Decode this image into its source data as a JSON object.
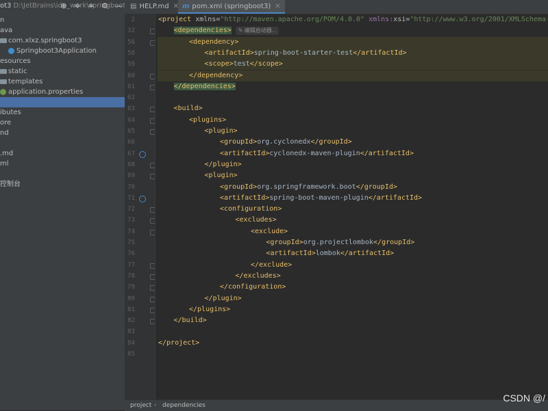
{
  "sidebar": {
    "project_name": "ot3",
    "project_path": "D:\\JetBrains\\ide_work\\springboot3",
    "toolbar_icons": [
      "locate-icon",
      "expand-all-icon",
      "collapse-all-icon",
      "gear-icon",
      "hide-icon"
    ],
    "tree": [
      {
        "label": "n",
        "kind": "text",
        "indent": 0
      },
      {
        "label": "ava",
        "kind": "text",
        "indent": 0
      },
      {
        "label": "com.xlxz.springboot3",
        "kind": "folder",
        "indent": 0
      },
      {
        "label": "Springboot3Application",
        "kind": "class",
        "indent": 1
      },
      {
        "label": "esources",
        "kind": "text",
        "indent": 0
      },
      {
        "label": "static",
        "kind": "folder",
        "indent": 0
      },
      {
        "label": "templates",
        "kind": "folder",
        "indent": 0
      },
      {
        "label": "application.properties",
        "kind": "leaf",
        "indent": 0
      },
      {
        "label": "",
        "kind": "selected",
        "indent": 0
      },
      {
        "label": "ibutes",
        "kind": "text",
        "indent": 0
      },
      {
        "label": "ore",
        "kind": "text",
        "indent": 0
      },
      {
        "label": "nd",
        "kind": "text",
        "indent": 0
      },
      {
        "label": "",
        "kind": "text",
        "indent": 0
      },
      {
        "label": ".md",
        "kind": "text",
        "indent": 0
      },
      {
        "label": "ml",
        "kind": "text",
        "indent": 0
      },
      {
        "label": "",
        "kind": "text",
        "indent": 0
      },
      {
        "label": "控制台",
        "kind": "text",
        "indent": 0
      }
    ]
  },
  "tabs": [
    {
      "label": "HELP.md",
      "icon": "markdown-icon",
      "active": false
    },
    {
      "label": "pom.xml (springboot3)",
      "icon": "maven-icon",
      "icon_char": "m",
      "active": true
    }
  ],
  "editor": {
    "inlay_hint": "编辑启动器...",
    "lines": [
      {
        "n": "2",
        "indent": 0,
        "tag": "<project",
        "attrs": [
          {
            "name": "xmlns",
            "value": "\"http://maven.apache.org/POM/4.0.0\""
          },
          {
            "ns": "xmlns:",
            "name": "xsi",
            "value": "\"http://www.w3.org/2001/XMLSchema-instanc"
          }
        ]
      },
      {
        "n": "32",
        "indent": 1,
        "open": "<dependencies>",
        "boxed": true,
        "inlay": true
      },
      {
        "n": "56",
        "indent": 2,
        "open": "<dependency>",
        "hl": true
      },
      {
        "n": "58",
        "indent": 3,
        "open": "<artifactId>",
        "text": "spring-boot-starter-test",
        "close": "</artifactId>",
        "hl": true
      },
      {
        "n": "59",
        "indent": 3,
        "open": "<scope>",
        "text": "test",
        "close": "</scope>",
        "hl": true
      },
      {
        "n": "60",
        "indent": 2,
        "open": "</dependency>",
        "hl": true
      },
      {
        "n": "61",
        "indent": 1,
        "open": "</dependencies>",
        "boxed": true
      },
      {
        "n": "62",
        "indent": 0,
        "open": ""
      },
      {
        "n": "63",
        "indent": 1,
        "open": "<build>"
      },
      {
        "n": "64",
        "indent": 2,
        "open": "<plugins>"
      },
      {
        "n": "65",
        "indent": 3,
        "open": "<plugin>"
      },
      {
        "n": "66",
        "indent": 4,
        "open": "<groupId>",
        "text": "org.cyclonedx",
        "close": "</groupId>"
      },
      {
        "n": "67",
        "indent": 4,
        "open": "<artifactId>",
        "text": "cyclonedx-maven-plugin",
        "close": "</artifactId>",
        "mark": true
      },
      {
        "n": "68",
        "indent": 3,
        "open": "</plugin>"
      },
      {
        "n": "69",
        "indent": 3,
        "open": "<plugin>"
      },
      {
        "n": "70",
        "indent": 4,
        "open": "<groupId>",
        "text": "org.springframework.boot",
        "close": "</groupId>"
      },
      {
        "n": "71",
        "indent": 4,
        "open": "<artifactId>",
        "text": "spring-boot-maven-plugin",
        "close": "</artifactId>",
        "mark": true
      },
      {
        "n": "72",
        "indent": 4,
        "open": "<configuration>"
      },
      {
        "n": "73",
        "indent": 5,
        "open": "<excludes>"
      },
      {
        "n": "74",
        "indent": 6,
        "open": "<exclude>"
      },
      {
        "n": "75",
        "indent": 7,
        "open": "<groupId>",
        "text": "org.projectlombok",
        "close": "</groupId>"
      },
      {
        "n": "76",
        "indent": 7,
        "open": "<artifactId>",
        "text": "lombok",
        "close": "</artifactId>"
      },
      {
        "n": "77",
        "indent": 6,
        "open": "</exclude>"
      },
      {
        "n": "78",
        "indent": 5,
        "open": "</excludes>"
      },
      {
        "n": "79",
        "indent": 4,
        "open": "</configuration>"
      },
      {
        "n": "80",
        "indent": 3,
        "open": "</plugin>"
      },
      {
        "n": "81",
        "indent": 2,
        "open": "</plugins>"
      },
      {
        "n": "82",
        "indent": 1,
        "open": "</build>"
      },
      {
        "n": "83",
        "indent": 0,
        "open": ""
      },
      {
        "n": "84",
        "indent": 0,
        "open": "</project>"
      },
      {
        "n": "85",
        "indent": 0,
        "open": ""
      }
    ]
  },
  "breadcrumb": [
    "project",
    "dependencies"
  ],
  "watermark": "CSDN @/"
}
